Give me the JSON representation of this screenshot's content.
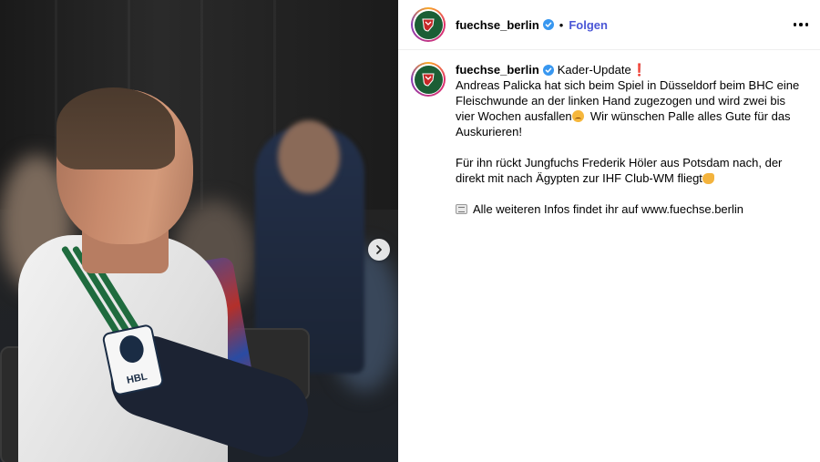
{
  "post": {
    "username": "fuechse_berlin",
    "follow_label": "Folgen",
    "separator": "•",
    "caption": {
      "username": "fuechse_berlin",
      "title": "Kader-Update",
      "exclamation": "❗",
      "paragraph1": "Andreas Palicka hat sich beim Spiel in Düsseldorf beim BHC eine Fleischwunde an der linken Hand zugezogen und wird zwei bis vier Wochen ausfallen",
      "paragraph1b": "  Wir wünschen Palle alles Gute für das Auskurieren!",
      "paragraph2": "Für ihn rückt Jungfuchs Frederik Höler aus Potsdam nach, der direkt mit nach Ägypten zur IHF Club-WM fliegt",
      "paragraph3": "Alle weiteren Infos findet ihr auf www.fuechse.berlin"
    },
    "photo": {
      "badge_text": "HBL"
    }
  },
  "colors": {
    "follow": "#4a56d6",
    "verified": "#3897f0",
    "club_green": "#1b5e35"
  },
  "icons": {
    "verified": "verified-badge-icon",
    "more": "more-options-icon",
    "next": "chevron-right-icon"
  }
}
